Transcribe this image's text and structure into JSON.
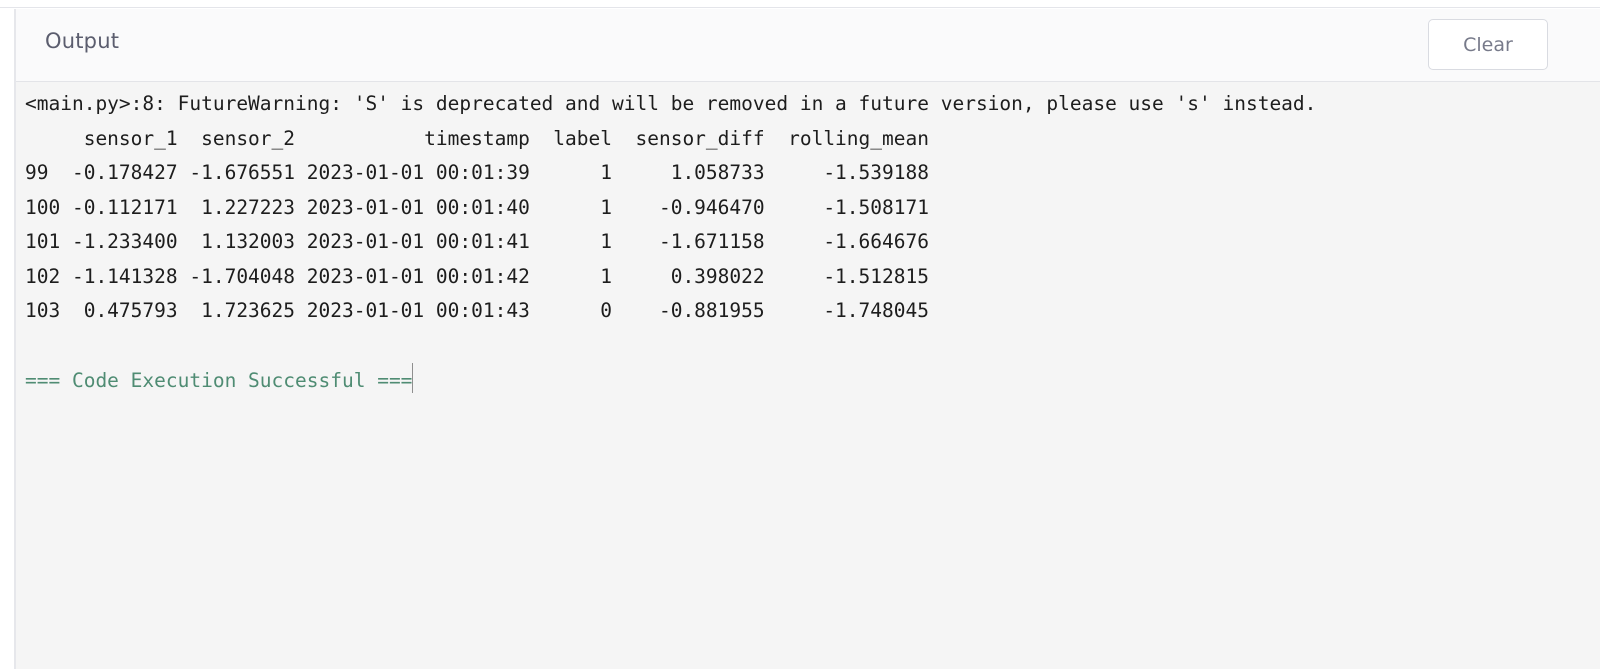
{
  "panel": {
    "title": "Output",
    "clear_label": "Clear"
  },
  "console": {
    "warning": "<main.py>:8: FutureWarning: 'S' is deprecated and will be removed in a future version, please use 's' instead.",
    "table_header": "     sensor_1  sensor_2           timestamp  label  sensor_diff  rolling_mean",
    "rows": [
      "99  -0.178427 -1.676551 2023-01-01 00:01:39      1     1.058733     -1.539188",
      "100 -0.112171  1.227223 2023-01-01 00:01:40      1    -0.946470     -1.508171",
      "101 -1.233400  1.132003 2023-01-01 00:01:41      1    -1.671158     -1.664676",
      "102 -1.141328 -1.704048 2023-01-01 00:01:42      1     0.398022     -1.512815",
      "103  0.475793  1.723625 2023-01-01 00:01:43      0    -0.881955     -1.748045"
    ],
    "success_message": "=== Code Execution Successful ==="
  }
}
